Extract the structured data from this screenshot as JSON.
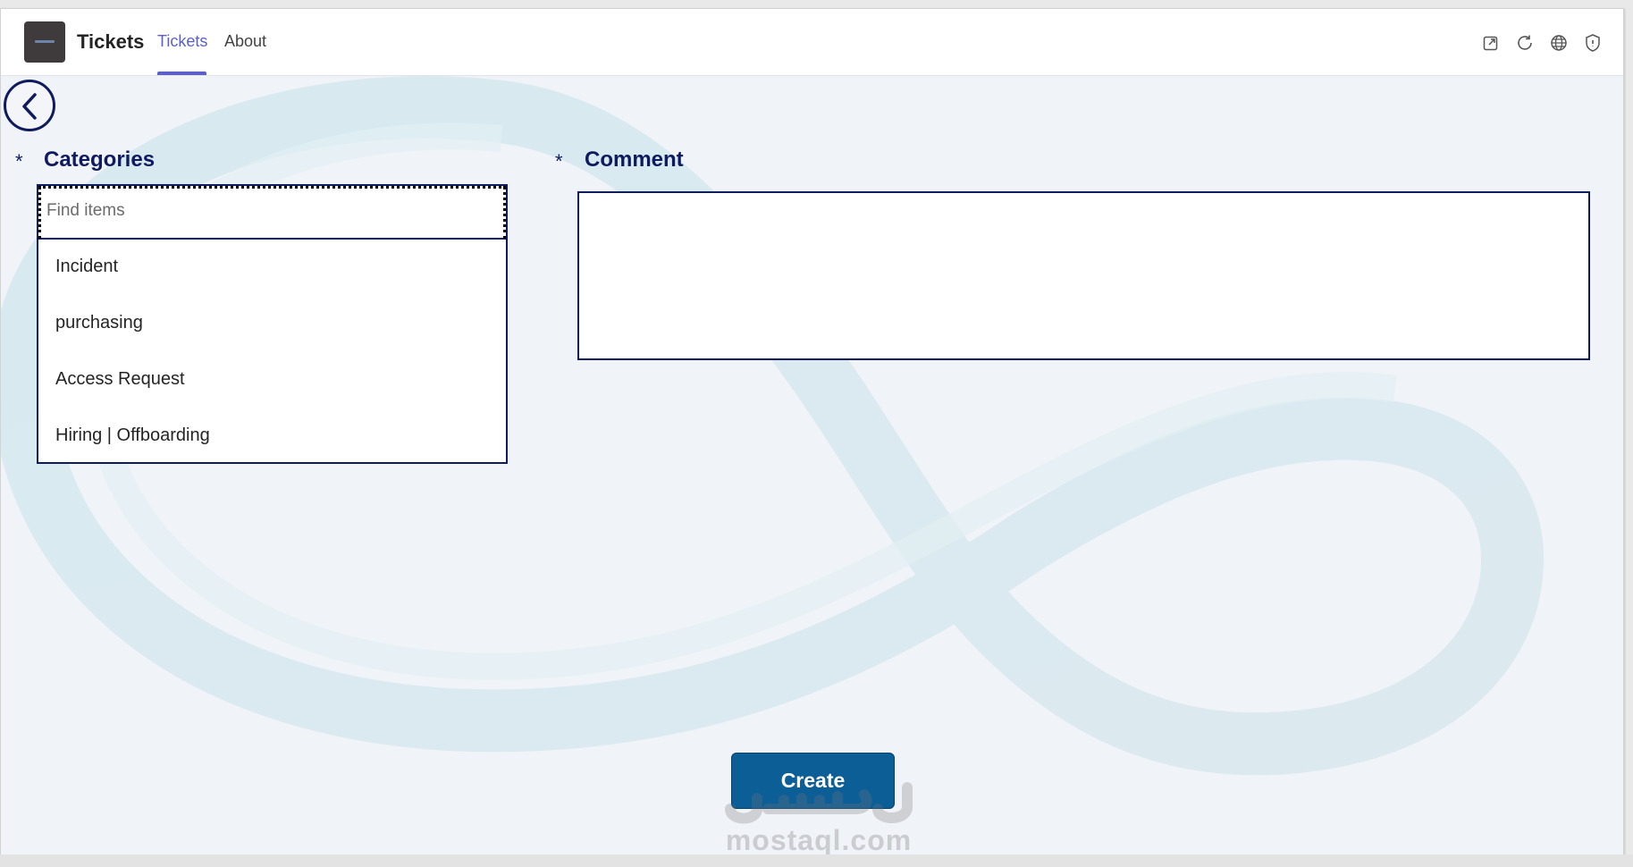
{
  "header": {
    "app_title": "Tickets",
    "tabs": [
      {
        "label": "Tickets",
        "active": true
      },
      {
        "label": "About",
        "active": false
      }
    ],
    "icons": [
      "popout-icon",
      "refresh-icon",
      "globe-icon",
      "shield-icon"
    ]
  },
  "form": {
    "categories": {
      "required_mark": "*",
      "label": "Categories",
      "search_placeholder": "Find items",
      "items": [
        {
          "label": "Incident"
        },
        {
          "label": "purchasing"
        },
        {
          "label": "Access Request"
        },
        {
          "label": "Hiring | Offboarding"
        }
      ]
    },
    "comment": {
      "required_mark": "*",
      "label": "Comment",
      "value": ""
    },
    "create_label": "Create"
  },
  "watermark": {
    "text": "mostaql.com",
    "logo_text": "مستقل"
  },
  "colors": {
    "accent": "#5b5fc7",
    "navy": "#0e1b5e",
    "button": "#0b5e96",
    "background": "#f0f3f8"
  }
}
